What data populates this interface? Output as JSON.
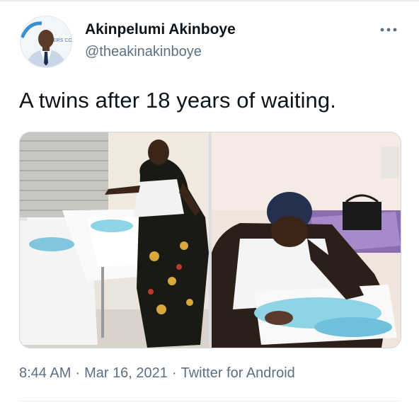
{
  "tweet": {
    "author_name": "Akinpelumi Akinboye",
    "author_handle": "@theakinakinboye",
    "text": "A twins after 18 years of waiting.",
    "time": "8:44 AM",
    "date": "Mar 16, 2021",
    "source": "Twitter for Android",
    "separator": "·",
    "more_icon": "more-horizontal-icon"
  },
  "colors": {
    "text_primary": "#0f1419",
    "text_secondary": "#5b7083",
    "divider": "#e6ecf0"
  }
}
